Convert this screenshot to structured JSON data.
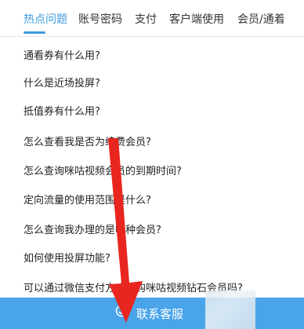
{
  "tabs": [
    {
      "label": "热点问题",
      "active": true
    },
    {
      "label": "账号密码",
      "active": false
    },
    {
      "label": "支付",
      "active": false
    },
    {
      "label": "客户端使用",
      "active": false
    },
    {
      "label": "会员/通着",
      "active": false
    }
  ],
  "questions": [
    "通看券有什么用?",
    "什么是近场投屏?",
    "抵值券有什么用?",
    "怎么查看我是否为续费会员?",
    "怎么查询咪咕视频会员的到期时间?",
    "定向流量的使用范围是什么?",
    "怎么查询我办理的是哪种会员?",
    "如何使用投屏功能?",
    "可以通过微信支付方式订购咪咕视频钻石会员吗?"
  ],
  "footer": {
    "label": "联系客服",
    "icon": "smile-icon"
  },
  "colors": {
    "accent": "#3d9be0",
    "footer_bg": "#49a4ea",
    "arrow": "#e8261f"
  }
}
